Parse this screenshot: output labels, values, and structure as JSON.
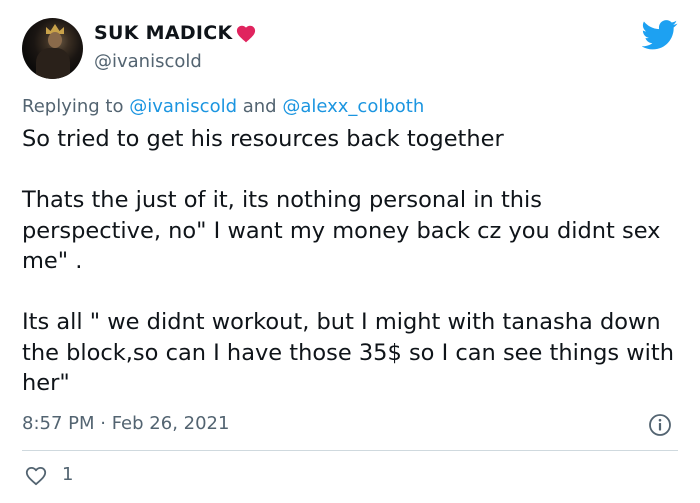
{
  "author": {
    "display_name": "SUK MADICK",
    "handle": "@ivaniscold",
    "name_emoji": "red-heart-icon"
  },
  "reply": {
    "prefix": "Replying to ",
    "mention_1": "@ivaniscold",
    "joiner": " and ",
    "mention_2": "@alexx_colboth"
  },
  "tweet": {
    "line_1": "So tried to get his resources back together",
    "para_2": "Thats the just of it, its nothing personal in this perspective, no\" I want my money back cz you didnt sex me\" .",
    "para_3": "Its all \" we didnt workout, but I might with tanasha down the block,so can I have those 35$ so I can see things with her\""
  },
  "meta": {
    "timestamp": "8:57 PM · Feb 26, 2021"
  },
  "actions": {
    "like_count": "1"
  },
  "colors": {
    "twitter_blue": "#1da1f2",
    "mention_blue": "#1b95e0",
    "secondary_text": "#536471",
    "heart_red": "#e0245e"
  },
  "icons": {
    "brand": "twitter-bird-icon",
    "info": "info-icon",
    "like": "heart-outline-icon"
  }
}
